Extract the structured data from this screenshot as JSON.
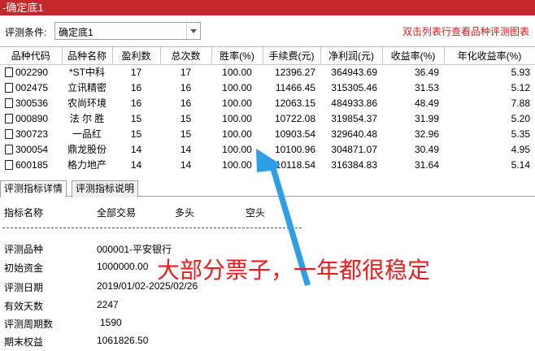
{
  "window": {
    "title": "-确定底1"
  },
  "toolbar": {
    "condition_label": "评测条件:",
    "condition_value": "确定底1",
    "hint": "双击列表行查看品种评测图表"
  },
  "table": {
    "headers": [
      "品种代码",
      "品种名称",
      "盈利数",
      "总次数",
      "胜率(%)",
      "手续费(元)",
      "净利润(元)",
      "收益率(%)",
      "年化收益率(%)"
    ],
    "rows": [
      [
        "002290",
        "*ST中科",
        "17",
        "17",
        "100.00",
        "12396.27",
        "364943.69",
        "36.49",
        "5.93"
      ],
      [
        "002475",
        "立讯精密",
        "16",
        "16",
        "100.00",
        "11466.45",
        "315305.46",
        "31.53",
        "5.12"
      ],
      [
        "300536",
        "农尚环境",
        "16",
        "16",
        "100.00",
        "12063.15",
        "484933.86",
        "48.49",
        "7.88"
      ],
      [
        "000890",
        "法 尔 胜",
        "15",
        "15",
        "100.00",
        "10722.08",
        "319854.37",
        "31.99",
        "5.20"
      ],
      [
        "300723",
        "一品红",
        "15",
        "15",
        "100.00",
        "10903.54",
        "329640.48",
        "32.96",
        "5.35"
      ],
      [
        "300054",
        "鼎龙股份",
        "14",
        "14",
        "100.00",
        "10100.96",
        "304871.07",
        "30.49",
        "4.95"
      ],
      [
        "600185",
        "格力地产",
        "14",
        "14",
        "100.00",
        "10118.54",
        "316384.83",
        "31.64",
        "5.14"
      ]
    ]
  },
  "tabs": [
    {
      "label": "评测指标详情"
    },
    {
      "label": "评测指标说明"
    }
  ],
  "detail": {
    "headers": [
      "指标名称",
      "全部交易",
      "多头",
      "空头"
    ],
    "items": [
      {
        "label": "评测品种",
        "value": "000001-平安银行"
      },
      {
        "label": "初始资金",
        "value": "1000000.00"
      },
      {
        "label": "评测日期",
        "value": "2019/01/02-2025/02/26"
      },
      {
        "label": "有效天数",
        "value": "2247"
      },
      {
        "label": "评测周期数",
        "value": "1590"
      },
      {
        "label": "期末权益",
        "value": "1061826.50"
      }
    ]
  },
  "annotation": {
    "text": "大部分票子，一年都很稳定",
    "color": "#ee1c1c",
    "arrow_color": "#2e9fe6"
  }
}
